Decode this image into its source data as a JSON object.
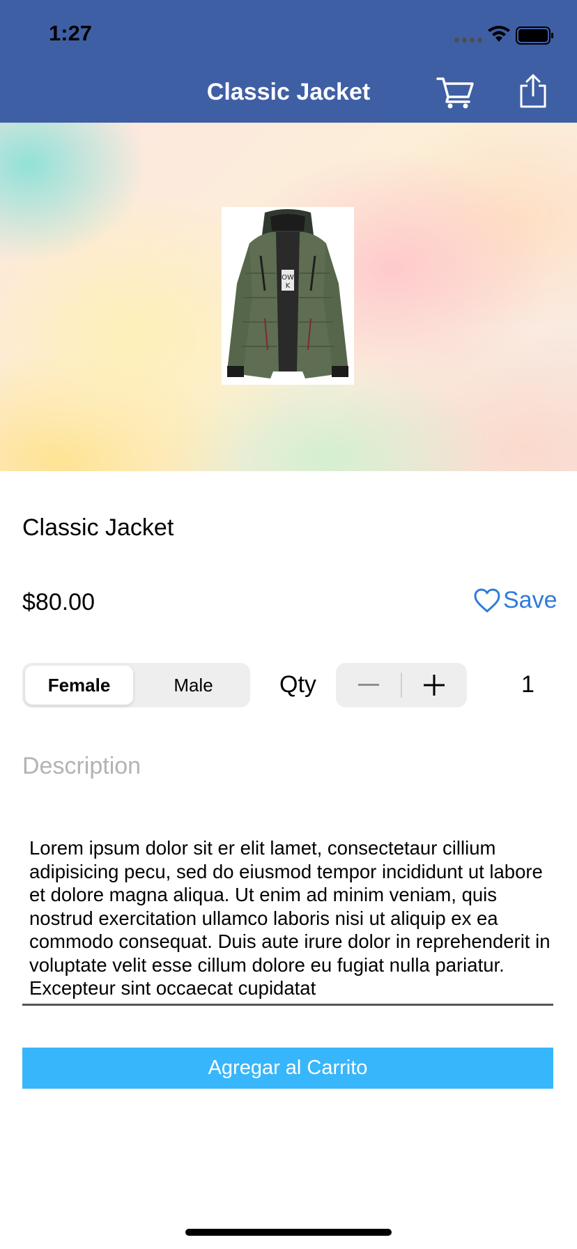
{
  "status_bar": {
    "time": "1:27"
  },
  "nav": {
    "title": "Classic Jacket",
    "icons": [
      "cart-icon",
      "share-icon"
    ]
  },
  "product": {
    "name": "Classic Jacket",
    "price": "$80.00",
    "save_label": "Save"
  },
  "options": {
    "gender": [
      "Female",
      "Male"
    ],
    "selected_gender": "Female",
    "qty_label": "Qty",
    "qty_value": "1"
  },
  "description": {
    "label": "Description",
    "text": "Lorem ipsum dolor sit er elit lamet, consectetaur cillium adipisicing pecu, sed do eiusmod tempor incididunt ut labore et dolore magna aliqua. Ut enim ad minim veniam, quis nostrud exercitation ullamco laboris nisi ut aliquip ex ea commodo consequat. Duis aute irure dolor in reprehenderit in voluptate velit esse cillum dolore eu fugiat nulla pariatur. Excepteur sint occaecat cupidatat"
  },
  "actions": {
    "add_to_cart": "Agregar al Carrito"
  },
  "colors": {
    "nav_bar": "#3f5fa5",
    "accent_blue": "#2f7bd8",
    "add_button": "#38b6fb",
    "placeholder_gray": "#b3b3b3"
  }
}
